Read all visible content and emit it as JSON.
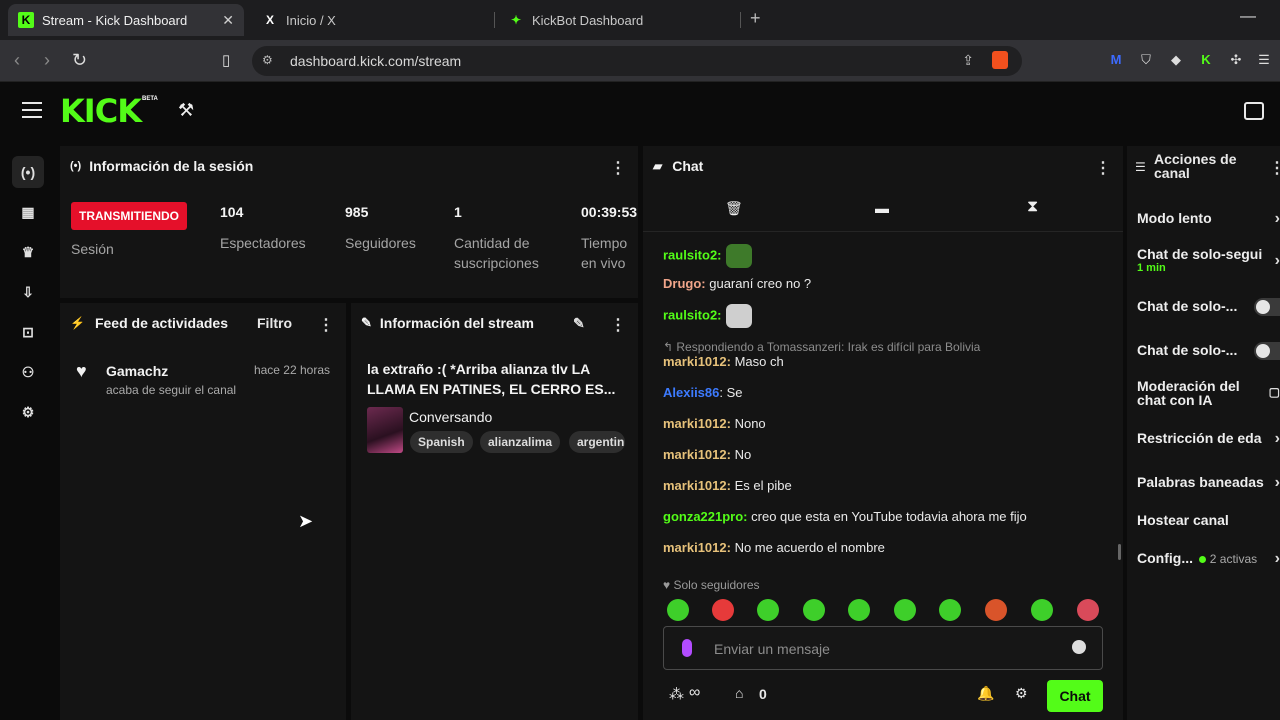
{
  "browser": {
    "tabs": [
      {
        "title": "Stream - Kick Dashboard",
        "favicon": "kick-icon"
      },
      {
        "title": "Inicio / X",
        "favicon": "x-icon"
      },
      {
        "title": "KickBot Dashboard",
        "favicon": "kickbot-icon"
      }
    ],
    "new_tab": "+",
    "url": "dashboard.kick.com/stream"
  },
  "app": {
    "logo": "KICK",
    "logo_beta": "BETA"
  },
  "session": {
    "title": "Información de la sesión",
    "badge": "TRANSMITIENDO",
    "badge_label": "Sesión",
    "stats": [
      {
        "value": "104",
        "label": "Espectadores"
      },
      {
        "value": "985",
        "label": "Seguidores"
      },
      {
        "value": "1",
        "label": "Cantidad de suscripciones"
      },
      {
        "value": "00:39:53",
        "label": "Tiempo en vivo"
      }
    ]
  },
  "feed": {
    "title": "Feed de actividades",
    "filter": "Filtro",
    "items": [
      {
        "user": "Gamachz",
        "time": "hace 22 horas",
        "text": "acaba de seguir el canal"
      }
    ]
  },
  "stream_info": {
    "title": "Información del stream",
    "stream_title": "la extraño :( *Arriba alianza tlv LA LLAMA EN PATINES, EL CERRO ES...",
    "category": "Conversando",
    "tags": [
      "Spanish",
      "alianzalima",
      "argentin"
    ]
  },
  "chat": {
    "title": "Chat",
    "messages": [
      {
        "user": "raulsito2:",
        "text": "",
        "color": "#53fc18",
        "emote": "#3e7a2a"
      },
      {
        "user": "Drugo:",
        "text": "guaraní creo no ?",
        "color": "#f0a58a"
      },
      {
        "user": "raulsito2:",
        "text": "",
        "color": "#53fc18",
        "emote": "#cfcfcf"
      },
      {
        "user": "marki1012:",
        "text": "Maso ch",
        "color": "#e6c17a"
      },
      {
        "user": "Alexiis86",
        "text": ": Se",
        "color": "#3d7bff"
      },
      {
        "user": "marki1012:",
        "text": "Nono",
        "color": "#e6c17a"
      },
      {
        "user": "marki1012:",
        "text": "No",
        "color": "#e6c17a"
      },
      {
        "user": "marki1012:",
        "text": "Es el pibe",
        "color": "#e6c17a"
      },
      {
        "user": "gonza221pro:",
        "text": "creo que esta en YouTube todavia ahora me fijo",
        "color": "#53fc18"
      },
      {
        "user": "marki1012:",
        "text": "No me acuerdo el nombre",
        "color": "#e6c17a"
      }
    ],
    "reply_hint": "Respondiendo a Tomassanzeri: Irak es difícil para Bolivia",
    "followers_only": "Solo seguidores",
    "input_placeholder": "Enviar un mensaje",
    "points": "0",
    "infinity": "∞",
    "send": "Chat"
  },
  "actions": {
    "title": "Acciones de canal",
    "items": [
      {
        "label": "Modo lento",
        "control": "arrow"
      },
      {
        "label": "Chat de solo-segui",
        "sub": "1 min",
        "control": "arrow"
      },
      {
        "label": "Chat de solo-...",
        "control": "toggle"
      },
      {
        "label": "Chat de solo-...",
        "control": "toggle"
      },
      {
        "label": "Moderación del chat con IA",
        "control": "box"
      },
      {
        "label": "Restricción de eda",
        "control": "arrow"
      },
      {
        "label": "Palabras baneadas",
        "control": "arrow"
      },
      {
        "label": "Hostear canal",
        "control": "none"
      },
      {
        "label": "Config...",
        "sub": "2 activas",
        "control": "arrow"
      }
    ]
  },
  "colors": {
    "brand": "#53fc18",
    "live": "#e5102a",
    "panel": "#141414"
  }
}
